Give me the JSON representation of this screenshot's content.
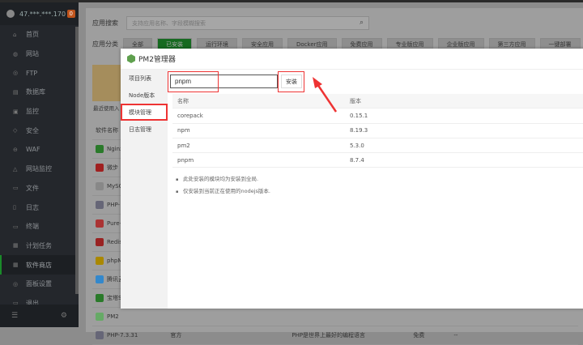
{
  "host": {
    "ip": "47.***.***.170",
    "badge": "0"
  },
  "sidebar": {
    "items": [
      {
        "label": "首页",
        "icon": "home-icon"
      },
      {
        "label": "网站",
        "icon": "globe-icon"
      },
      {
        "label": "FTP",
        "icon": "ftp-icon"
      },
      {
        "label": "数据库",
        "icon": "database-icon"
      },
      {
        "label": "监控",
        "icon": "monitor-icon"
      },
      {
        "label": "安全",
        "icon": "shield-icon"
      },
      {
        "label": "WAF",
        "icon": "waf-icon"
      },
      {
        "label": "网站监控",
        "icon": "chart-icon"
      },
      {
        "label": "文件",
        "icon": "folder-icon"
      },
      {
        "label": "日志",
        "icon": "log-icon"
      },
      {
        "label": "终端",
        "icon": "terminal-icon"
      },
      {
        "label": "计划任务",
        "icon": "calendar-icon"
      },
      {
        "label": "软件商店",
        "icon": "grid-icon",
        "active": true
      },
      {
        "label": "面板设置",
        "icon": "settings-icon"
      },
      {
        "label": "退出",
        "icon": "logout-icon"
      }
    ]
  },
  "main": {
    "search_label": "应用搜索",
    "search_placeholder": "支持应用名称、字段模糊搜索",
    "category_label": "应用分类",
    "categories": [
      "全部",
      "已安装",
      "运行环境",
      "安全应用",
      "Docker应用",
      "免费应用",
      "专业版应用",
      "企业版应用",
      "第三方应用",
      "一键部署"
    ],
    "active_category": "已安装",
    "recent_label": "最近使用入",
    "table_header": "软件名称",
    "bg_rows": [
      "Nginx",
      "微步",
      "MySQL",
      "PHP-",
      "Pure-",
      "Redis",
      "phpM",
      "腾讯云",
      "宝塔S",
      "PM2",
      "PHP-7.3.31"
    ],
    "last_row": {
      "type": "官方",
      "desc": "PHP是世界上最好的编程语言",
      "price": "免费",
      "expire": "--"
    }
  },
  "modal": {
    "title": "PM2管理器",
    "tabs": [
      "项目列表",
      "Node版本",
      "模块管理",
      "日志管理"
    ],
    "active_tab": "模块管理",
    "input_value": "pnpm",
    "install_label": "安装",
    "columns": [
      "名称",
      "版本"
    ],
    "rows": [
      [
        "corepack",
        "0.15.1"
      ],
      [
        "npm",
        "8.19.3"
      ],
      [
        "pm2",
        "5.3.0"
      ],
      [
        "pnpm",
        "8.7.4"
      ]
    ],
    "notes": [
      "此处安装的模块均为安装到全局.",
      "仅安装到当前正在使用的nodejs版本."
    ]
  },
  "colors": {
    "accent": "#20a53a",
    "highlight": "#e33333"
  }
}
